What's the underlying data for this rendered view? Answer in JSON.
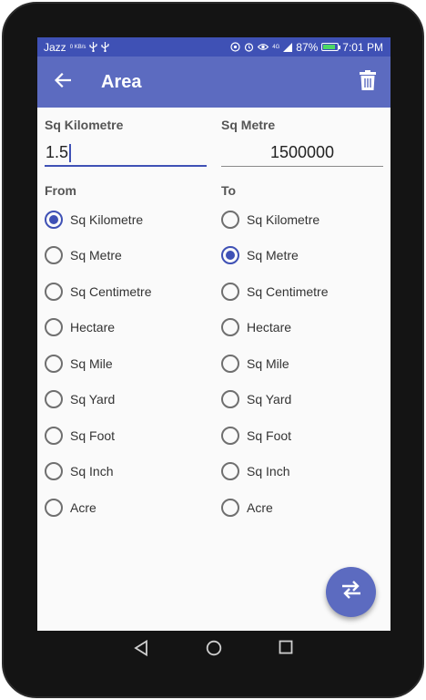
{
  "status_bar": {
    "carrier": "Jazz",
    "net_speed": "0 KB/s",
    "network_type": "4G",
    "battery_percent": "87%",
    "battery_level": 0.87,
    "time": "7:01 PM",
    "icons": [
      "usb-icon",
      "usb-icon",
      "hotspot-icon",
      "alarm-icon",
      "eye-icon",
      "signal-icon",
      "battery-icon"
    ]
  },
  "app_bar": {
    "title": "Area",
    "back_icon": "arrow-back-icon",
    "delete_icon": "trash-icon",
    "background": "#5c6bc0"
  },
  "converter": {
    "from_unit_label": "Sq Kilometre",
    "from_value": "1.5",
    "to_unit_label": "Sq Metre",
    "to_value": "1500000"
  },
  "from_group": {
    "label": "From",
    "selected": "Sq Kilometre",
    "options": [
      "Sq Kilometre",
      "Sq Metre",
      "Sq Centimetre",
      "Hectare",
      "Sq Mile",
      "Sq Yard",
      "Sq Foot",
      "Sq Inch",
      "Acre"
    ]
  },
  "to_group": {
    "label": "To",
    "selected": "Sq Metre",
    "options": [
      "Sq Kilometre",
      "Sq Metre",
      "Sq Centimetre",
      "Hectare",
      "Sq Mile",
      "Sq Yard",
      "Sq Foot",
      "Sq Inch",
      "Acre"
    ]
  },
  "fab": {
    "icon": "swap-icon",
    "color": "#5c6bc0"
  },
  "nav": {
    "icons": [
      "back-triangle-icon",
      "home-circle-icon",
      "recents-square-icon"
    ]
  },
  "accent": "#3f51b5"
}
